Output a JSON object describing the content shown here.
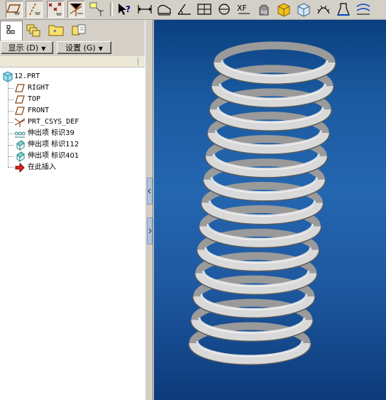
{
  "toolbar": {
    "buttons": [
      {
        "id": "datum-plane",
        "icon": "datum-plane-icon"
      },
      {
        "id": "datum-axis",
        "icon": "datum-axis-icon"
      },
      {
        "id": "datum-point",
        "icon": "datum-point-icon"
      },
      {
        "id": "datum-csys",
        "icon": "datum-csys-icon"
      },
      {
        "id": "annotation",
        "icon": "annotation-icon"
      },
      {
        "id": "context-help",
        "icon": "context-help-icon"
      },
      {
        "id": "measure-distance",
        "icon": "measure-distance-icon"
      },
      {
        "id": "measure-area",
        "icon": "measure-area-icon"
      },
      {
        "id": "measure-angle",
        "icon": "measure-angle-icon"
      },
      {
        "id": "measure-section",
        "icon": "measure-section-icon"
      },
      {
        "id": "measure-curve",
        "icon": "measure-curve-icon"
      },
      {
        "id": "mass-properties",
        "icon": "mass-properties-icon"
      },
      {
        "id": "analysis-tools",
        "icon": "analysis-tools-icon"
      },
      {
        "id": "model-analysis",
        "icon": "model-analysis-icon"
      },
      {
        "id": "saved-analysis",
        "icon": "saved-analysis-icon"
      },
      {
        "id": "curvature",
        "icon": "curvature-icon"
      },
      {
        "id": "draft-check",
        "icon": "draft-check-icon"
      },
      {
        "id": "surface-analysis",
        "icon": "surface-analysis-icon"
      }
    ]
  },
  "left_panel": {
    "tabs": [
      "model-tree-tab",
      "layers-tab",
      "folder-tab",
      "favorites-tab"
    ],
    "show_button": "显示 (D)",
    "settings_button": "设置 (G)"
  },
  "model_tree": {
    "root": "12.PRT",
    "items": [
      {
        "label": "RIGHT",
        "icon": "datum-plane-icon"
      },
      {
        "label": "TOP",
        "icon": "datum-plane-icon"
      },
      {
        "label": "FRONT",
        "icon": "datum-plane-icon"
      },
      {
        "label": "PRT_CSYS_DEF",
        "icon": "coordinate-system-icon"
      },
      {
        "label": "伸出项 标识39",
        "icon": "sweep-spring-icon"
      },
      {
        "label": "伸出项 标识112",
        "icon": "extrude-icon"
      },
      {
        "label": "伸出项 标识401",
        "icon": "extrude-icon"
      },
      {
        "label": "在此插入",
        "icon": "insert-here-arrow-icon"
      }
    ]
  },
  "viewport": {
    "model": "helical-spring",
    "colors": {
      "background_top": "#0a3f7f",
      "background_mid": "#2466b0",
      "spring": "#d9d9d9"
    }
  }
}
